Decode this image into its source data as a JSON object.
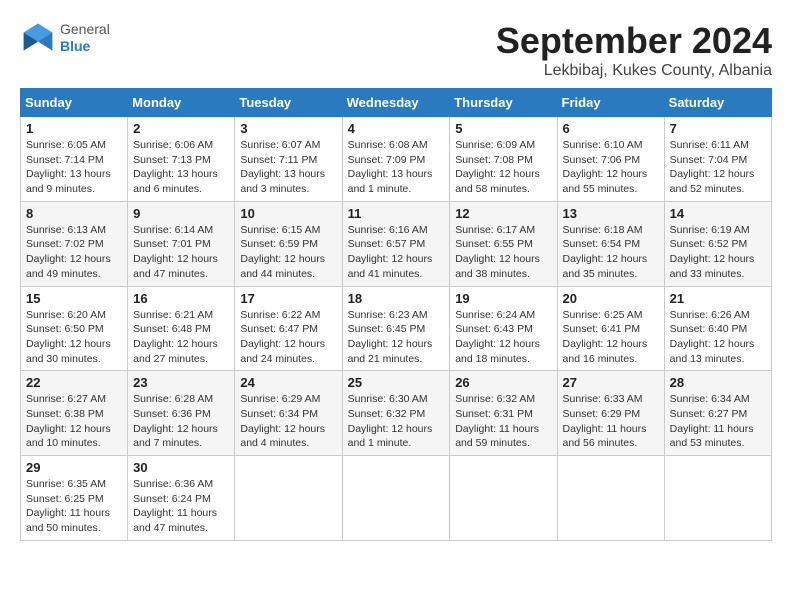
{
  "header": {
    "logo_general": "General",
    "logo_blue": "Blue",
    "month": "September 2024",
    "location": "Lekbibaj, Kukes County, Albania"
  },
  "weekdays": [
    "Sunday",
    "Monday",
    "Tuesday",
    "Wednesday",
    "Thursday",
    "Friday",
    "Saturday"
  ],
  "weeks": [
    [
      {
        "day": "1",
        "info": "Sunrise: 6:05 AM\nSunset: 7:14 PM\nDaylight: 13 hours and 9 minutes."
      },
      {
        "day": "2",
        "info": "Sunrise: 6:06 AM\nSunset: 7:13 PM\nDaylight: 13 hours and 6 minutes."
      },
      {
        "day": "3",
        "info": "Sunrise: 6:07 AM\nSunset: 7:11 PM\nDaylight: 13 hours and 3 minutes."
      },
      {
        "day": "4",
        "info": "Sunrise: 6:08 AM\nSunset: 7:09 PM\nDaylight: 13 hours and 1 minute."
      },
      {
        "day": "5",
        "info": "Sunrise: 6:09 AM\nSunset: 7:08 PM\nDaylight: 12 hours and 58 minutes."
      },
      {
        "day": "6",
        "info": "Sunrise: 6:10 AM\nSunset: 7:06 PM\nDaylight: 12 hours and 55 minutes."
      },
      {
        "day": "7",
        "info": "Sunrise: 6:11 AM\nSunset: 7:04 PM\nDaylight: 12 hours and 52 minutes."
      }
    ],
    [
      {
        "day": "8",
        "info": "Sunrise: 6:13 AM\nSunset: 7:02 PM\nDaylight: 12 hours and 49 minutes."
      },
      {
        "day": "9",
        "info": "Sunrise: 6:14 AM\nSunset: 7:01 PM\nDaylight: 12 hours and 47 minutes."
      },
      {
        "day": "10",
        "info": "Sunrise: 6:15 AM\nSunset: 6:59 PM\nDaylight: 12 hours and 44 minutes."
      },
      {
        "day": "11",
        "info": "Sunrise: 6:16 AM\nSunset: 6:57 PM\nDaylight: 12 hours and 41 minutes."
      },
      {
        "day": "12",
        "info": "Sunrise: 6:17 AM\nSunset: 6:55 PM\nDaylight: 12 hours and 38 minutes."
      },
      {
        "day": "13",
        "info": "Sunrise: 6:18 AM\nSunset: 6:54 PM\nDaylight: 12 hours and 35 minutes."
      },
      {
        "day": "14",
        "info": "Sunrise: 6:19 AM\nSunset: 6:52 PM\nDaylight: 12 hours and 33 minutes."
      }
    ],
    [
      {
        "day": "15",
        "info": "Sunrise: 6:20 AM\nSunset: 6:50 PM\nDaylight: 12 hours and 30 minutes."
      },
      {
        "day": "16",
        "info": "Sunrise: 6:21 AM\nSunset: 6:48 PM\nDaylight: 12 hours and 27 minutes."
      },
      {
        "day": "17",
        "info": "Sunrise: 6:22 AM\nSunset: 6:47 PM\nDaylight: 12 hours and 24 minutes."
      },
      {
        "day": "18",
        "info": "Sunrise: 6:23 AM\nSunset: 6:45 PM\nDaylight: 12 hours and 21 minutes."
      },
      {
        "day": "19",
        "info": "Sunrise: 6:24 AM\nSunset: 6:43 PM\nDaylight: 12 hours and 18 minutes."
      },
      {
        "day": "20",
        "info": "Sunrise: 6:25 AM\nSunset: 6:41 PM\nDaylight: 12 hours and 16 minutes."
      },
      {
        "day": "21",
        "info": "Sunrise: 6:26 AM\nSunset: 6:40 PM\nDaylight: 12 hours and 13 minutes."
      }
    ],
    [
      {
        "day": "22",
        "info": "Sunrise: 6:27 AM\nSunset: 6:38 PM\nDaylight: 12 hours and 10 minutes."
      },
      {
        "day": "23",
        "info": "Sunrise: 6:28 AM\nSunset: 6:36 PM\nDaylight: 12 hours and 7 minutes."
      },
      {
        "day": "24",
        "info": "Sunrise: 6:29 AM\nSunset: 6:34 PM\nDaylight: 12 hours and 4 minutes."
      },
      {
        "day": "25",
        "info": "Sunrise: 6:30 AM\nSunset: 6:32 PM\nDaylight: 12 hours and 1 minute."
      },
      {
        "day": "26",
        "info": "Sunrise: 6:32 AM\nSunset: 6:31 PM\nDaylight: 11 hours and 59 minutes."
      },
      {
        "day": "27",
        "info": "Sunrise: 6:33 AM\nSunset: 6:29 PM\nDaylight: 11 hours and 56 minutes."
      },
      {
        "day": "28",
        "info": "Sunrise: 6:34 AM\nSunset: 6:27 PM\nDaylight: 11 hours and 53 minutes."
      }
    ],
    [
      {
        "day": "29",
        "info": "Sunrise: 6:35 AM\nSunset: 6:25 PM\nDaylight: 11 hours and 50 minutes."
      },
      {
        "day": "30",
        "info": "Sunrise: 6:36 AM\nSunset: 6:24 PM\nDaylight: 11 hours and 47 minutes."
      },
      null,
      null,
      null,
      null,
      null
    ]
  ]
}
